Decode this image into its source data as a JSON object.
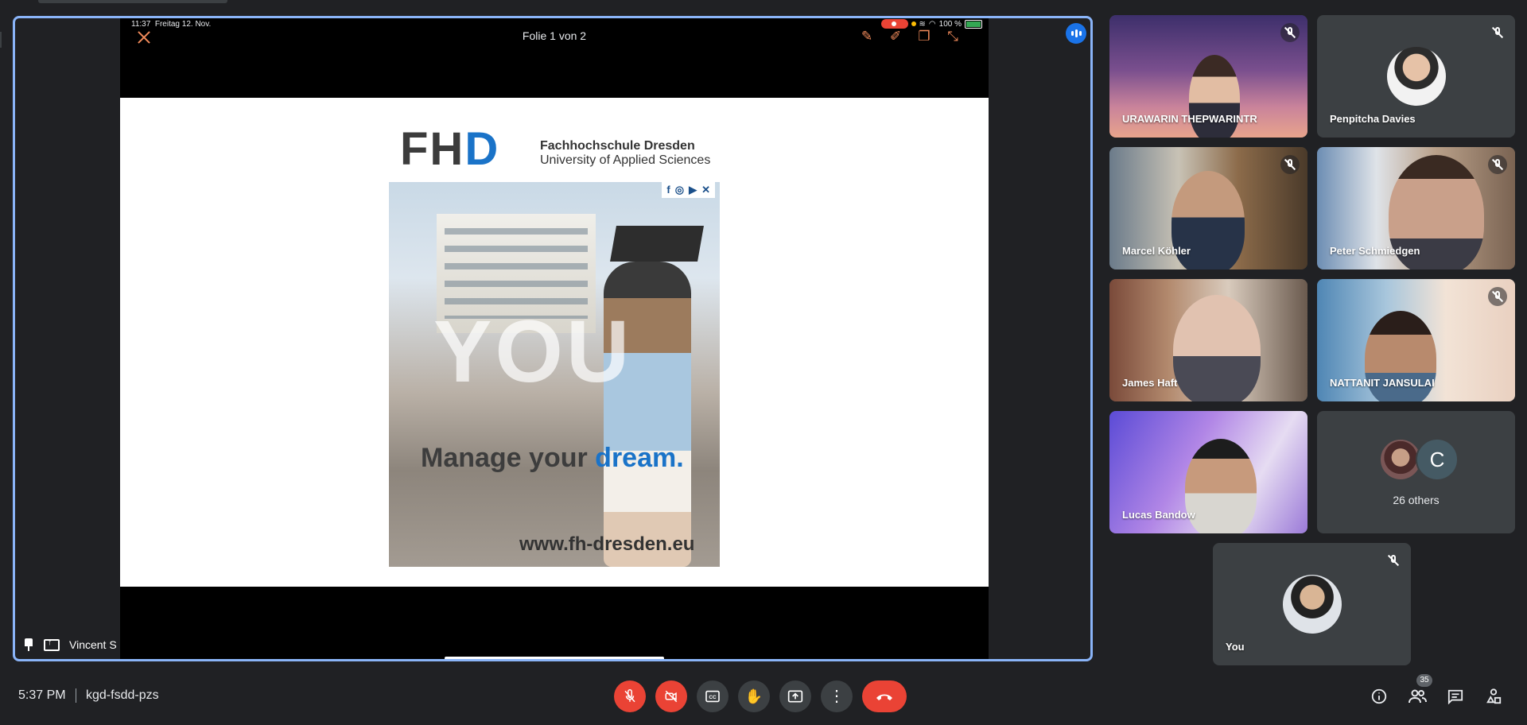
{
  "tablet_status": {
    "time": "11:37",
    "date": "Freitag 12. Nov.",
    "battery": "100 %"
  },
  "presentation": {
    "slide_counter": "Folie 1 von 2",
    "presenter_name": "Vincent S"
  },
  "slide": {
    "logo_fh": "FH",
    "logo_d": "D",
    "school_name": "Fachhochschule Dresden",
    "school_subtitle": "University of Applied Sciences",
    "big_word": "YOU",
    "tagline_start": "Manage your ",
    "tagline_accent": "dream.",
    "website": "www.fh-dresden.eu"
  },
  "participants": [
    {
      "name": "URAWARIN THEPWARINTR",
      "muted": true
    },
    {
      "name": "Penpitcha Davies",
      "muted": true
    },
    {
      "name": "Marcel Köhler",
      "muted": true
    },
    {
      "name": "Peter Schmiedgen",
      "muted": true
    },
    {
      "name": "James Haft",
      "muted": false
    },
    {
      "name": "NATTANIT JANSULAI",
      "muted": true
    },
    {
      "name": "Lucas Bandow",
      "muted": false
    }
  ],
  "others": {
    "initial": "C",
    "label": "26 others"
  },
  "self": {
    "name": "You"
  },
  "meeting": {
    "time": "5:37 PM",
    "code": "kgd-fsdd-pzs",
    "people_count": "35"
  },
  "icons": {
    "mic_off": "mic-off-icon",
    "cam_off": "videocam-off-icon",
    "captions": "captions-icon",
    "hand": "raise-hand-icon",
    "present": "present-now-icon",
    "more": "more-vert-icon",
    "hangup": "call-end-icon",
    "info": "info-icon",
    "people": "people-icon",
    "chat": "chat-icon",
    "activities": "activities-icon"
  },
  "colors": {
    "accent_blue": "#8ab4f8",
    "danger_red": "#ea4335",
    "bg": "#202124",
    "tile": "#3c4043"
  }
}
